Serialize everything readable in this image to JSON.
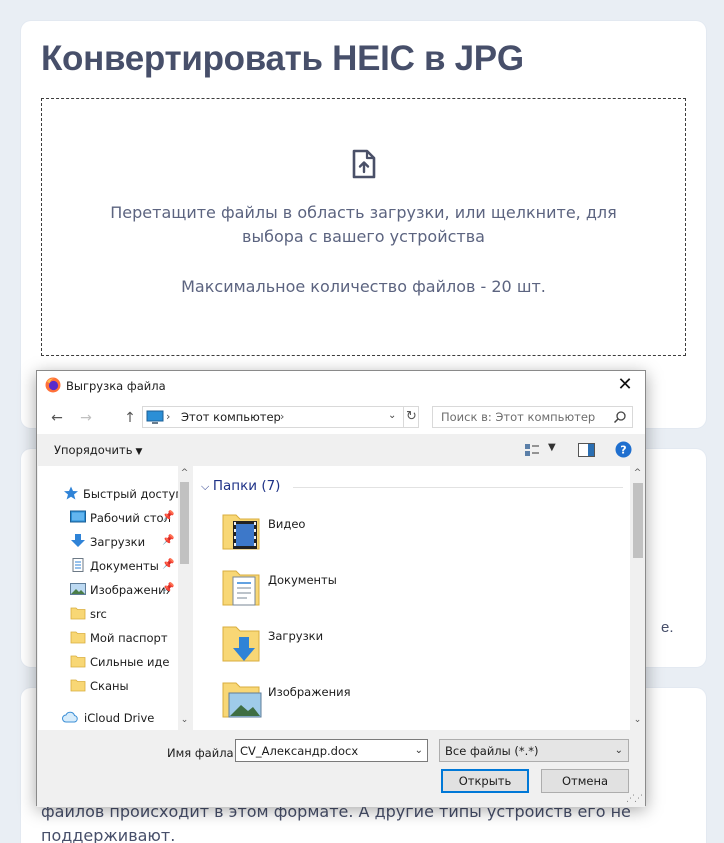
{
  "page": {
    "title": "Конвертировать HEIC в JPG",
    "dropzone": {
      "line1": "Перетащите файлы в область загрузки, или щелкните, для",
      "line2": "выбора с вашего устройства",
      "max_files": "Максимальное количество файлов - 20 шт."
    },
    "bg_fragment_dot": "е.",
    "bg_text_line1": "файлов происходит в этом формате. А другие типы устройств его не",
    "bg_text_line2": "поддерживают."
  },
  "dialog": {
    "title": "Выгрузка файла",
    "address": "Этот компьютер",
    "search_placeholder": "Поиск в: Этот компьютер",
    "organize_label": "Упорядочить",
    "nav_items": [
      {
        "label": "Быстрый доступ",
        "icon": "star-icon",
        "pinned": false
      },
      {
        "label": "Рабочий стол",
        "icon": "desktop-icon",
        "pinned": true
      },
      {
        "label": "Загрузки",
        "icon": "download-arrow-icon",
        "pinned": true
      },
      {
        "label": "Документы",
        "icon": "document-icon",
        "pinned": true
      },
      {
        "label": "Изображения",
        "icon": "pictures-icon",
        "pinned": true
      },
      {
        "label": "src",
        "icon": "folder-icon",
        "pinned": false
      },
      {
        "label": "Мой паспорт",
        "icon": "folder-icon",
        "pinned": false
      },
      {
        "label": "Сильные идеи",
        "icon": "folder-icon",
        "pinned": false
      },
      {
        "label": "Сканы",
        "icon": "folder-icon",
        "pinned": false
      },
      {
        "label": "iCloud Drive",
        "icon": "cloud-icon",
        "pinned": false
      }
    ],
    "group_header": "Папки (7)",
    "folders": [
      {
        "label": "Видео",
        "icon": "video-folder-icon"
      },
      {
        "label": "Документы",
        "icon": "documents-folder-icon"
      },
      {
        "label": "Загрузки",
        "icon": "downloads-folder-icon"
      },
      {
        "label": "Изображения",
        "icon": "pictures-folder-icon"
      }
    ],
    "filename_label": "Имя файла:",
    "filename_value": "CV_Александр.docx",
    "filetype_value": "Все файлы (*.*)",
    "open_button": "Открыть",
    "cancel_button": "Отмена"
  },
  "colors": {
    "title": "#474f6a",
    "accent_blue": "#0078d7",
    "group_header": "#1e3287",
    "folder_yellow": "#f8d775"
  }
}
